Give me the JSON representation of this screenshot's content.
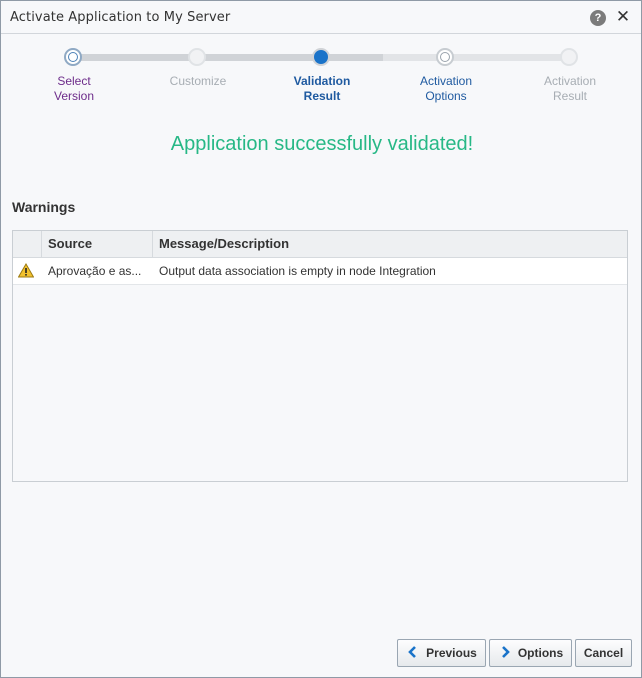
{
  "window": {
    "title": "Activate Application to My Server",
    "help_symbol": "?",
    "close_symbol": "✕"
  },
  "train": {
    "stops": [
      {
        "line1": "Select",
        "line2": "Version",
        "state": "visited"
      },
      {
        "line1": "Customize",
        "line2": "",
        "state": "disabled"
      },
      {
        "line1": "Validation",
        "line2": "Result",
        "state": "current"
      },
      {
        "line1": "Activation",
        "line2": "Options",
        "state": "enabled"
      },
      {
        "line1": "Activation",
        "line2": "Result",
        "state": "disabled"
      }
    ]
  },
  "status": {
    "message": "Application successfully validated!",
    "color": "#27b886"
  },
  "warnings": {
    "heading": "Warnings",
    "columns": [
      "Source",
      "Message/Description"
    ],
    "rows": [
      {
        "icon": "warning-icon",
        "source": "Aprovação e as...",
        "message": "Output data association is empty in node Integration"
      }
    ]
  },
  "footer": {
    "previous_label": "Previous",
    "options_label": "Options",
    "cancel_label": "Cancel"
  }
}
